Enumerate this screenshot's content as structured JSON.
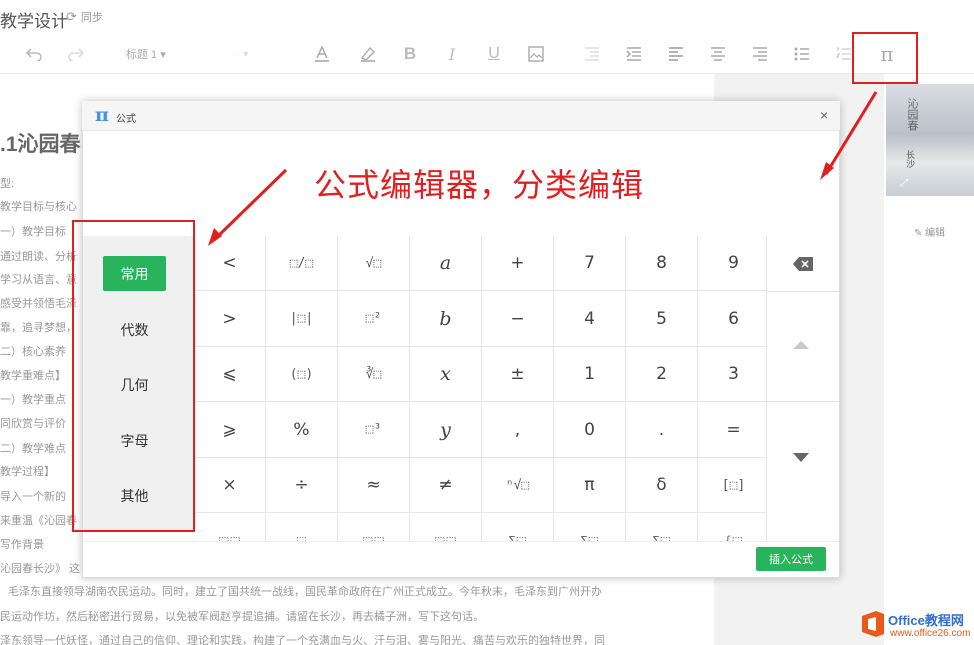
{
  "header": {
    "doc_title": "教学设计",
    "sync_label": "同步"
  },
  "toolbar": {
    "heading_select": "标题 1",
    "bold": "B",
    "italic": "I",
    "underline": "U",
    "formula_icon": "π"
  },
  "document": {
    "heading": ".1沁园春",
    "lines": [
      "型:",
      "教学目标与核心",
      "一）教学目标",
      "通过朗读、分析",
      "学习从语言、意",
      "感受并领悟毛泽",
      "靠，追寻梦想，",
      "二）核心素养",
      "教学重难点】",
      "一）教学重点",
      "同欣赏与评价",
      "二）教学难点",
      "教学过程】",
      "导入一个新的",
      "来重温《沁园春",
      "写作背景",
      "沁园春长沙》 这",
      "毛泽东直接领导湖南农民运动。同时，建立了国共统一战线，国民革命政府在广州正式成立。今年秋末，毛泽东到广州开办",
      "民运动作坊，然后秘密进行贸易，以免被军阀赵亨提追捕。请留在长沙，再去橘子洲，写下这句话。",
      "泽东领导一代妖怪，通过自己的信仰、理论和实践，构建了一个充满血与火、汗与泪、雾与阳光、痛苦与欢乐的独特世界，同"
    ]
  },
  "side_panel": {
    "thumbnail_text_1": "沁园春",
    "thumbnail_text_2": "长沙",
    "edit_label": "编辑"
  },
  "dialog": {
    "icon": "π",
    "title": "公式",
    "close": "×",
    "categories": [
      "常用",
      "代数",
      "几何",
      "字母",
      "其他"
    ],
    "active_category": "常用",
    "keys": [
      [
        "<",
        "⬚/⬚",
        "√⬚",
        "a",
        "+",
        "7",
        "8",
        "9"
      ],
      [
        ">",
        "|⬚|",
        "⬚²",
        "b",
        "−",
        "4",
        "5",
        "6"
      ],
      [
        "⩽",
        "(⬚)",
        "∛⬚",
        "x",
        "±",
        "1",
        "2",
        "3"
      ],
      [
        "⩾",
        "%",
        "⬚³",
        "y",
        ",",
        "0",
        ".",
        "="
      ],
      [
        "×",
        "÷",
        "≈",
        "≠",
        "ⁿ√⬚",
        "π",
        "δ",
        "[⬚]"
      ],
      [
        "⬚⬚",
        "⬚",
        "⬚⬚",
        "⬚⬚",
        "Σ⬚",
        "Σ⬚",
        "Σ⬚",
        "{⬚"
      ]
    ],
    "insert_button": "插入公式"
  },
  "annotation": {
    "text": "公式编辑器，分类编辑",
    "color": "#e02020"
  },
  "watermark": {
    "line1": "Office教程网",
    "line2": "www.office26.com"
  },
  "colors": {
    "accent_green": "#27b45c",
    "pi_blue": "#4a90e2"
  }
}
